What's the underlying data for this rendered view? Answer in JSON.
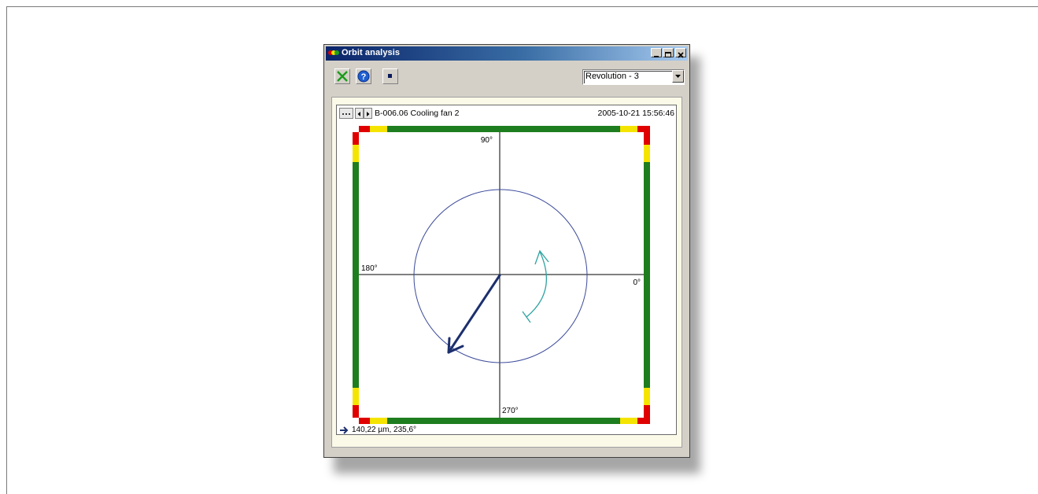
{
  "window": {
    "title": "Orbit analysis",
    "controls": {
      "minimize": "_",
      "maximize": "□",
      "close": "×"
    }
  },
  "toolbar": {
    "buttons": [
      "close-x-icon",
      "help-icon",
      "stop-icon"
    ],
    "select": {
      "value": "Revolution - 3"
    }
  },
  "header": {
    "machine": "B-006.06  Cooling fan 2",
    "timestamp": "2005-10-21 15:56:46"
  },
  "plot": {
    "labels": {
      "top": "90°",
      "left": "180°",
      "right": "0°",
      "bottom": "270°"
    },
    "orbit_circle_color": "#3b4a9a",
    "vector_color": "#1c2f6e",
    "rotation_arrow_color": "#2fa3a3",
    "band_colors": {
      "ok": "#1e7d1e",
      "warning": "#f5e400",
      "alarm": "#e00000"
    }
  },
  "footer": {
    "reading": "140,22 µm, 235,6°"
  }
}
